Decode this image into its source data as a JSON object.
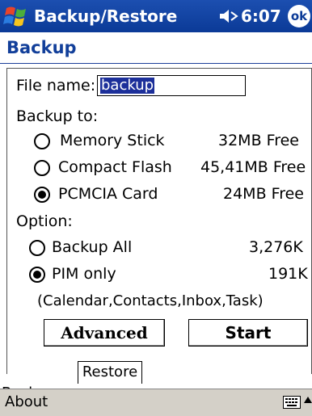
{
  "titlebar": {
    "title": "Backup/Restore",
    "time": "6:07",
    "ok_label": "ok"
  },
  "heading": "Backup",
  "file": {
    "label": "File name:",
    "value": "backup"
  },
  "backup_to": {
    "label": "Backup to:",
    "options": [
      {
        "label": "Memory Stick",
        "free": "32MB Free",
        "selected": false
      },
      {
        "label": "Compact Flash",
        "free": "45,41MB Free",
        "selected": false
      },
      {
        "label": "PCMCIA Card",
        "free": "24MB Free",
        "selected": true
      }
    ]
  },
  "option": {
    "label": "Option:",
    "options": [
      {
        "label": "Backup All",
        "size": "3,276K",
        "selected": false
      },
      {
        "label": "PIM only",
        "size": "191K",
        "selected": true
      }
    ],
    "note": "(Calendar,Contacts,Inbox,Task)"
  },
  "buttons": {
    "advanced": "Advanced",
    "start": "Start"
  },
  "tabs": {
    "backup": "Backup",
    "restore": "Restore"
  },
  "cmdbar": {
    "about": "About"
  }
}
